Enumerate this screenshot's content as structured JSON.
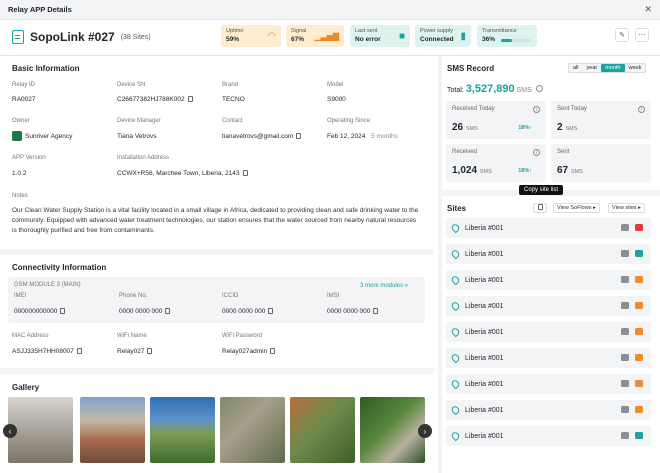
{
  "window": {
    "title": "Relay APP Details"
  },
  "header": {
    "title": "SopoLink #027",
    "subtitle": "(38 Sites)"
  },
  "stats": [
    {
      "label": "Uptime",
      "value": "59%",
      "icon": "wifi-icon",
      "color": "#fdeccd"
    },
    {
      "label": "Signal",
      "value": "67%",
      "icon": "signal-bars-icon",
      "color": "#fdeccd"
    },
    {
      "label": "Last sent",
      "value": "No error",
      "icon": "message-icon",
      "color": "#dff3ee"
    },
    {
      "label": "Power supply",
      "value": "Connected",
      "icon": "battery-icon",
      "color": "#dff3ee"
    },
    {
      "label": "Transmittance",
      "value": "36%",
      "progress": 0.36,
      "color": "#dff3ee"
    }
  ],
  "basic": {
    "title": "Basic Information",
    "relay_id": {
      "label": "Relay ID",
      "value": "RA0027"
    },
    "device_sn": {
      "label": "Device SN",
      "value": "C26677382HJ788K002"
    },
    "brand": {
      "label": "Brand",
      "value": "TECNO"
    },
    "model": {
      "label": "Model",
      "value": "S9000"
    },
    "owner": {
      "label": "Owner",
      "value": "Sunriver Agency"
    },
    "manager": {
      "label": "Device Manager",
      "value": "Tiana Vetrovs"
    },
    "contact": {
      "label": "Contact",
      "value": "tianavetrovs@gmail.com"
    },
    "operating": {
      "label": "Operating Since",
      "value": "Feb 12, 2024",
      "ago": "5 months"
    },
    "app_version": {
      "label": "APP Version",
      "value": "1.0.2"
    },
    "address": {
      "label": "Installation Address",
      "value": "CCWX+R56, Marchee Town, Liberia, 2143"
    },
    "notes_label": "Notes",
    "notes": "Our Clean Water Supply Station is a vital facility located in a small village in Africa, dedicated to providing clean and safe drinking water to the community. Equipped with advanced water treatment technologies, our station ensures that the water sourced from nearby natural resources is thoroughly purified and free from contaminants."
  },
  "connectivity": {
    "title": "Connectivity Information",
    "module": "GSM MODULE 3 (MAIN)",
    "more": "3 more modules »",
    "imei": {
      "label": "IMEI",
      "value": "000000000000"
    },
    "phone": {
      "label": "Phone No.",
      "value": "0000 0000 000"
    },
    "iccid": {
      "label": "ICCID",
      "value": "0000 0000 000"
    },
    "imsi": {
      "label": "IMSI",
      "value": "0000 0000 000"
    },
    "mac": {
      "label": "MAC Address",
      "value": "ASJJ335H7HH08007"
    },
    "wifi_name": {
      "label": "WiFi Name",
      "value": "Relay027"
    },
    "wifi_pass": {
      "label": "WiFi Password",
      "value": "Relay027admin"
    }
  },
  "gallery": {
    "title": "Gallery"
  },
  "sms": {
    "title": "SMS Record",
    "periods": [
      "all",
      "year",
      "month",
      "week"
    ],
    "active_period": "month",
    "total_label": "Total:",
    "total": "3,527,890",
    "total_unit": "SMS",
    "cards": [
      {
        "label": "Received Today",
        "value": "26",
        "unit": "SMS",
        "pct": "18%↑"
      },
      {
        "label": "Sent Today",
        "value": "2",
        "unit": "SMS",
        "pct": ""
      },
      {
        "label": "Received",
        "value": "1,024",
        "unit": "SMS",
        "pct": "18%↑"
      },
      {
        "label": "Sent",
        "value": "67",
        "unit": "SMS",
        "pct": ""
      }
    ]
  },
  "sites": {
    "title": "Sites",
    "tooltip": "Copy site list",
    "view_flows": "View SoFlows ▸",
    "view_sites": "View sites ▸",
    "items": [
      {
        "name": "Liberia #001",
        "status": "#e53935"
      },
      {
        "name": "Liberia #001",
        "status": "#1aa3a3"
      },
      {
        "name": "Liberia #001",
        "status": "#f08c2e"
      },
      {
        "name": "Liberia #001",
        "status": "#f08c2e"
      },
      {
        "name": "Liberia #001",
        "status": "#f08c2e"
      },
      {
        "name": "Liberia #001",
        "status": "#f08c2e"
      },
      {
        "name": "Liberia #001",
        "status": "#f08c2e"
      },
      {
        "name": "Liberia #001",
        "status": "#f08c2e"
      },
      {
        "name": "Liberia #001",
        "status": "#1aa3a3"
      }
    ]
  }
}
